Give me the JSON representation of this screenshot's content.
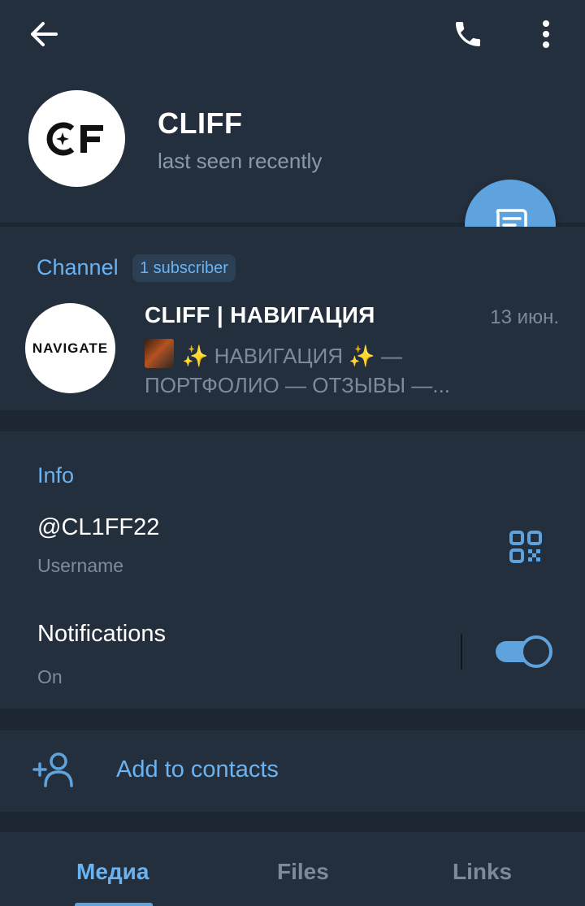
{
  "header": {
    "back_icon": "arrow-left-icon",
    "call_icon": "phone-icon",
    "more_icon": "more-vertical-icon",
    "avatar_text": "CF",
    "name": "CLIFF",
    "status": "last seen recently",
    "message_icon": "chat-message-icon"
  },
  "channel": {
    "label": "Channel",
    "badge": "1 subscriber",
    "avatar_text": "NAVIGATE",
    "name": "CLIFF | НАВИГАЦИЯ",
    "date": "13 июн.",
    "message_line1": "✨ НАВИГАЦИЯ ✨  —",
    "message_line2": "ПОРТФОЛИО  — ОТЗЫВЫ  —..."
  },
  "info": {
    "label": "Info",
    "username": "@CL1FF22",
    "username_label": "Username",
    "qr_icon": "qr-code-icon",
    "notifications_title": "Notifications",
    "notifications_status": "On",
    "notifications_enabled": true
  },
  "actions": {
    "add_contact_icon": "add-user-icon",
    "add_contact_label": "Add to contacts"
  },
  "tabs": [
    {
      "label": "Медиа",
      "active": true
    },
    {
      "label": "Files",
      "active": false
    },
    {
      "label": "Links",
      "active": false
    }
  ],
  "colors": {
    "background": "#1d2733",
    "surface": "#242f3d",
    "accent": "#6ab3f3",
    "accent_fill": "#5fa3de",
    "muted_text": "#7d8b99"
  }
}
